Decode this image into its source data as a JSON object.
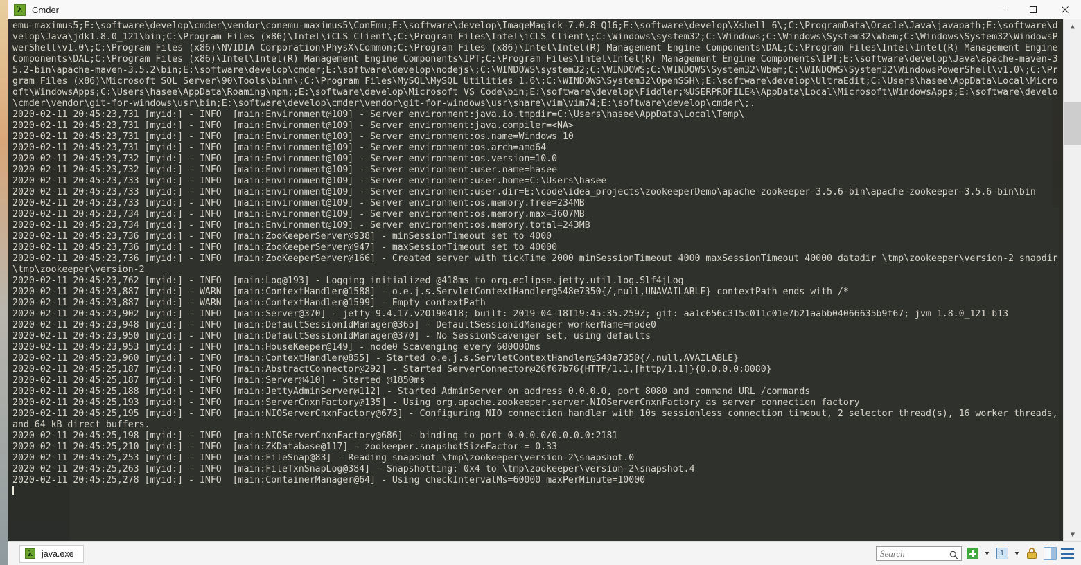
{
  "window": {
    "title": "Cmder",
    "app_icon": "lambda-icon",
    "controls": {
      "minimize": "minimize-icon",
      "maximize": "maximize-icon",
      "close": "close-icon"
    }
  },
  "terminal": {
    "cursor_visible": true,
    "lines": [
      "emu-maximus5;E:\\software\\develop\\cmder\\vendor\\conemu-maximus5\\ConEmu;E:\\software\\develop\\ImageMagick-7.0.8-Q16;E:\\software\\develop\\Xshell 6\\;C:\\ProgramData\\Oracle\\Java\\javapath;E:\\software\\d",
      "velop\\Java\\jdk1.8.0_121\\bin;C:\\Program Files (x86)\\Intel\\iCLS Client\\;C:\\Program Files\\Intel\\iCLS Client\\;C:\\Windows\\system32;C:\\Windows;C:\\Windows\\System32\\Wbem;C:\\Windows\\System32\\WindowsP",
      "werShell\\v1.0\\;C:\\Program Files (x86)\\NVIDIA Corporation\\PhysX\\Common;C:\\Program Files (x86)\\Intel\\Intel(R) Management Engine Components\\DAL;C:\\Program Files\\Intel\\Intel(R) Management Engine",
      "Components\\DAL;C:\\Program Files (x86)\\Intel\\Intel(R) Management Engine Components\\IPT;C:\\Program Files\\Intel\\Intel(R) Management Engine Components\\IPT;E:\\software\\develop\\Java\\apache-maven-3",
      "5.2-bin\\apache-maven-3.5.2\\bin;E:\\software\\develop\\cmder;E:\\software\\develop\\nodejs\\;C:\\WINDOWS\\system32;C:\\WINDOWS;C:\\WINDOWS\\System32\\Wbem;C:\\WINDOWS\\System32\\WindowsPowerShell\\v1.0\\;C:\\Pr",
      "gram Files (x86)\\Microsoft SQL Server\\90\\Tools\\binn\\;C:\\Program Files\\MySQL\\MySQL Utilities 1.6\\;C:\\WINDOWS\\System32\\OpenSSH\\;E:\\software\\develop\\UltraEdit;C:\\Users\\hasee\\AppData\\Local\\Micro",
      "oft\\WindowsApps;C:\\Users\\hasee\\AppData\\Roaming\\npm;;E:\\software\\develop\\Microsoft VS Code\\bin;E:\\software\\develop\\Fiddler;%USERPROFILE%\\AppData\\Local\\Microsoft\\WindowsApps;E:\\software\\develo",
      "\\cmder\\vendor\\git-for-windows\\usr\\bin;E:\\software\\develop\\cmder\\vendor\\git-for-windows\\usr\\share\\vim\\vim74;E:\\software\\develop\\cmder\\;.",
      "2020-02-11 20:45:23,731 [myid:] - INFO  [main:Environment@109] - Server environment:java.io.tmpdir=C:\\Users\\hasee\\AppData\\Local\\Temp\\",
      "2020-02-11 20:45:23,731 [myid:] - INFO  [main:Environment@109] - Server environment:java.compiler=<NA>",
      "2020-02-11 20:45:23,731 [myid:] - INFO  [main:Environment@109] - Server environment:os.name=Windows 10",
      "2020-02-11 20:45:23,731 [myid:] - INFO  [main:Environment@109] - Server environment:os.arch=amd64",
      "2020-02-11 20:45:23,732 [myid:] - INFO  [main:Environment@109] - Server environment:os.version=10.0",
      "2020-02-11 20:45:23,732 [myid:] - INFO  [main:Environment@109] - Server environment:user.name=hasee",
      "2020-02-11 20:45:23,733 [myid:] - INFO  [main:Environment@109] - Server environment:user.home=C:\\Users\\hasee",
      "2020-02-11 20:45:23,733 [myid:] - INFO  [main:Environment@109] - Server environment:user.dir=E:\\code\\idea_projects\\zookeeperDemo\\apache-zookeeper-3.5.6-bin\\apache-zookeeper-3.5.6-bin\\bin",
      "2020-02-11 20:45:23,733 [myid:] - INFO  [main:Environment@109] - Server environment:os.memory.free=234MB",
      "2020-02-11 20:45:23,734 [myid:] - INFO  [main:Environment@109] - Server environment:os.memory.max=3607MB",
      "2020-02-11 20:45:23,734 [myid:] - INFO  [main:Environment@109] - Server environment:os.memory.total=243MB",
      "2020-02-11 20:45:23,736 [myid:] - INFO  [main:ZooKeeperServer@938] - minSessionTimeout set to 4000",
      "2020-02-11 20:45:23,736 [myid:] - INFO  [main:ZooKeeperServer@947] - maxSessionTimeout set to 40000",
      "2020-02-11 20:45:23,736 [myid:] - INFO  [main:ZooKeeperServer@166] - Created server with tickTime 2000 minSessionTimeout 4000 maxSessionTimeout 40000 datadir \\tmp\\zookeeper\\version-2 snapdir",
      "\\tmp\\zookeeper\\version-2",
      "2020-02-11 20:45:23,762 [myid:] - INFO  [main:Log@193] - Logging initialized @418ms to org.eclipse.jetty.util.log.Slf4jLog",
      "2020-02-11 20:45:23,887 [myid:] - WARN  [main:ContextHandler@1588] - o.e.j.s.ServletContextHandler@548e7350{/,null,UNAVAILABLE} contextPath ends with /*",
      "2020-02-11 20:45:23,887 [myid:] - WARN  [main:ContextHandler@1599] - Empty contextPath",
      "2020-02-11 20:45:23,902 [myid:] - INFO  [main:Server@370] - jetty-9.4.17.v20190418; built: 2019-04-18T19:45:35.259Z; git: aa1c656c315c011c01e7b21aabb04066635b9f67; jvm 1.8.0_121-b13",
      "2020-02-11 20:45:23,948 [myid:] - INFO  [main:DefaultSessionIdManager@365] - DefaultSessionIdManager workerName=node0",
      "2020-02-11 20:45:23,950 [myid:] - INFO  [main:DefaultSessionIdManager@370] - No SessionScavenger set, using defaults",
      "2020-02-11 20:45:23,953 [myid:] - INFO  [main:HouseKeeper@149] - node0 Scavenging every 600000ms",
      "2020-02-11 20:45:23,960 [myid:] - INFO  [main:ContextHandler@855] - Started o.e.j.s.ServletContextHandler@548e7350{/,null,AVAILABLE}",
      "2020-02-11 20:45:25,187 [myid:] - INFO  [main:AbstractConnector@292] - Started ServerConnector@26f67b76{HTTP/1.1,[http/1.1]}{0.0.0.0:8080}",
      "2020-02-11 20:45:25,187 [myid:] - INFO  [main:Server@410] - Started @1850ms",
      "2020-02-11 20:45:25,188 [myid:] - INFO  [main:JettyAdminServer@112] - Started AdminServer on address 0.0.0.0, port 8080 and command URL /commands",
      "2020-02-11 20:45:25,193 [myid:] - INFO  [main:ServerCnxnFactory@135] - Using org.apache.zookeeper.server.NIOServerCnxnFactory as server connection factory",
      "2020-02-11 20:45:25,195 [myid:] - INFO  [main:NIOServerCnxnFactory@673] - Configuring NIO connection handler with 10s sessionless connection timeout, 2 selector thread(s), 16 worker threads,",
      "and 64 kB direct buffers.",
      "2020-02-11 20:45:25,198 [myid:] - INFO  [main:NIOServerCnxnFactory@686] - binding to port 0.0.0.0/0.0.0.0:2181",
      "2020-02-11 20:45:25,210 [myid:] - INFO  [main:ZKDatabase@117] - zookeeper.snapshotSizeFactor = 0.33",
      "2020-02-11 20:45:25,253 [myid:] - INFO  [main:FileSnap@83] - Reading snapshot \\tmp\\zookeeper\\version-2\\snapshot.0",
      "2020-02-11 20:45:25,263 [myid:] - INFO  [main:FileTxnSnapLog@384] - Snapshotting: 0x4 to \\tmp\\zookeeper\\version-2\\snapshot.4",
      "2020-02-11 20:45:25,278 [myid:] - INFO  [main:ContainerManager@64] - Using checkIntervalMs=60000 maxPerMinute=10000"
    ]
  },
  "scrollbar": {
    "up_arrow": "chevron-up-icon",
    "down_arrow": "chevron-down-icon"
  },
  "statusbar": {
    "tabs": [
      {
        "label": "java.exe",
        "icon": "lambda-icon",
        "active": true
      }
    ],
    "search": {
      "value": "",
      "placeholder": "Search",
      "icon": "search-icon"
    },
    "new_console_label": "+",
    "active_console_index": "1",
    "icons": {
      "new_console": "plus-icon",
      "new_console_menu": "chevron-down-icon",
      "console_selector": "console-window-icon",
      "console_selector_menu": "chevron-down-icon",
      "lock": "lock-icon",
      "split_panes": "split-pane-icon",
      "main_menu": "hamburger-menu-icon"
    }
  },
  "colors": {
    "terminal_bg": "#262824",
    "terminal_fg": "#d8d5c8",
    "titlebar_bg": "#f8f8f8",
    "statusbar_bg": "#f4f4f4",
    "accent_green": "#3faa3f",
    "accent_blue": "#2e6ba8",
    "lock_gold": "#e0b73f"
  }
}
